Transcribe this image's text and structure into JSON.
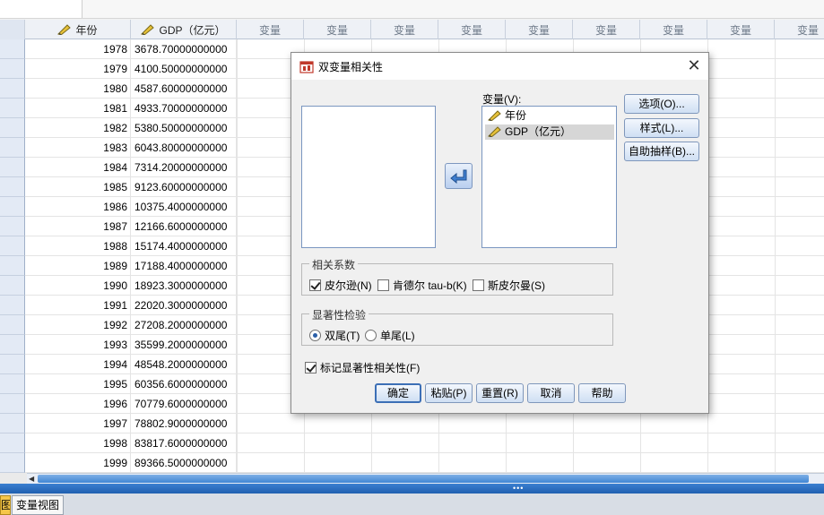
{
  "grid": {
    "headers": [
      {
        "label": "年份",
        "icon": "ruler-pencil-icon"
      },
      {
        "label": "GDP（亿元）",
        "icon": "ruler-pencil-icon"
      }
    ],
    "empty_var_label": "变量",
    "empty_var_count": 9,
    "rows": [
      {
        "year": "1978",
        "gdp": "3678.70000000000"
      },
      {
        "year": "1979",
        "gdp": "4100.50000000000"
      },
      {
        "year": "1980",
        "gdp": "4587.60000000000"
      },
      {
        "year": "1981",
        "gdp": "4933.70000000000"
      },
      {
        "year": "1982",
        "gdp": "5380.50000000000"
      },
      {
        "year": "1983",
        "gdp": "6043.80000000000"
      },
      {
        "year": "1984",
        "gdp": "7314.20000000000"
      },
      {
        "year": "1985",
        "gdp": "9123.60000000000"
      },
      {
        "year": "1986",
        "gdp": "10375.4000000000"
      },
      {
        "year": "1987",
        "gdp": "12166.6000000000"
      },
      {
        "year": "1988",
        "gdp": "15174.4000000000"
      },
      {
        "year": "1989",
        "gdp": "17188.4000000000"
      },
      {
        "year": "1990",
        "gdp": "18923.3000000000"
      },
      {
        "year": "1991",
        "gdp": "22020.3000000000"
      },
      {
        "year": "1992",
        "gdp": "27208.2000000000"
      },
      {
        "year": "1993",
        "gdp": "35599.2000000000"
      },
      {
        "year": "1994",
        "gdp": "48548.2000000000"
      },
      {
        "year": "1995",
        "gdp": "60356.6000000000"
      },
      {
        "year": "1996",
        "gdp": "70779.6000000000"
      },
      {
        "year": "1997",
        "gdp": "78802.9000000000"
      },
      {
        "year": "1998",
        "gdp": "83817.6000000000"
      },
      {
        "year": "1999",
        "gdp": "89366.5000000000"
      }
    ]
  },
  "tabs": {
    "data_view": "图",
    "variable_view": "变量视图"
  },
  "dialog": {
    "title": "双变量相关性",
    "close_glyph": "✕",
    "variables_label": "变量(V):",
    "variables": [
      {
        "label": "年份",
        "selected": false
      },
      {
        "label": "GDP（亿元）",
        "selected": true
      }
    ],
    "side_buttons": {
      "options": "选项(O)...",
      "style": "样式(L)...",
      "bootstrap": "自助抽样(B)..."
    },
    "correlation_group": {
      "legend": "相关系数",
      "pearson": {
        "label": "皮尔逊(N)",
        "checked": true
      },
      "kendall": {
        "label": "肯德尔 tau-b(K)",
        "checked": false
      },
      "spearman": {
        "label": "斯皮尔曼(S)",
        "checked": false
      }
    },
    "significance_group": {
      "legend": "显著性检验",
      "two_tailed": {
        "label": "双尾(T)",
        "selected": true
      },
      "one_tailed": {
        "label": "单尾(L)",
        "selected": false
      }
    },
    "flag_significant": {
      "label": "标记显著性相关性(F)",
      "checked": true
    },
    "buttons": {
      "ok": "确定",
      "paste": "粘贴(P)",
      "reset": "重置(R)",
      "cancel": "取消",
      "help": "帮助"
    }
  }
}
